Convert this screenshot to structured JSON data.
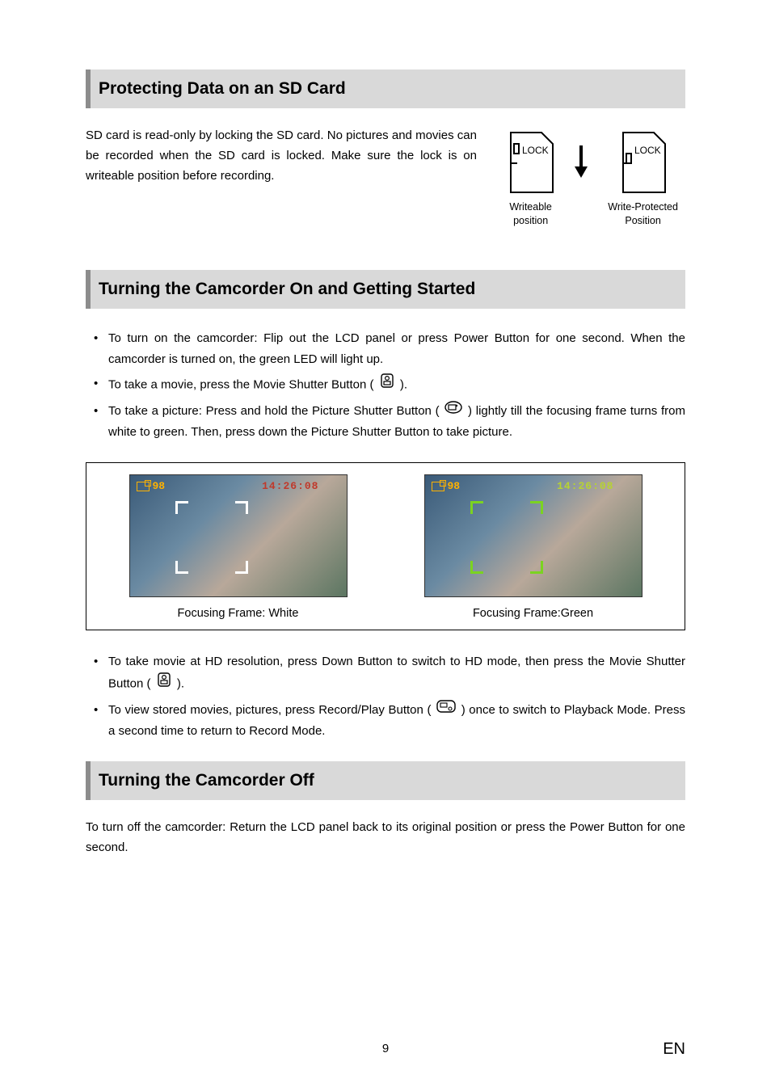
{
  "section1": {
    "title": "Protecting Data on an SD Card",
    "intro": "SD card is read-only by locking the SD card. No pictures and movies can be recorded when the SD card is locked. Make sure the lock is on writeable position before recording.",
    "sd_lock_label": "LOCK",
    "writeable_caption": "Writeable position",
    "protected_caption": "Write-Protected Position"
  },
  "section2": {
    "title": "Turning the Camcorder On and Getting Started",
    "bullets_a": [
      "To turn on the camcorder: Flip out the LCD panel or press Power Button for one second. When the camcorder is turned on, the green LED will light up.",
      "To take a movie, press the Movie Shutter Button (",
      "To take a picture: Press and hold the Picture Shutter Button ("
    ],
    "bullet_a2_tail": ").",
    "bullet_a3_tail": ") lightly till the focusing frame turns from white to green. Then, press down the Picture Shutter Button to take picture.",
    "figure": {
      "osd_count": "98",
      "osd_time": "14:26:08",
      "caption_white": "Focusing Frame: White",
      "caption_green": "Focusing Frame:Green"
    },
    "bullets_b_1a": "To take movie at HD resolution, press Down Button to switch to HD mode, then press the Movie Shutter Button (",
    "bullets_b_1b": ").",
    "bullets_b_2a": "To view stored movies, pictures, press Record/Play Button (",
    "bullets_b_2b": ") once to switch to Playback Mode. Press a second time to return to Record Mode."
  },
  "section3": {
    "title": "Turning the Camcorder Off",
    "body": "To turn off the camcorder: Return the LCD panel back to its original position or press the Power Button for one second."
  },
  "footer": {
    "page": "9",
    "lang": "EN"
  }
}
